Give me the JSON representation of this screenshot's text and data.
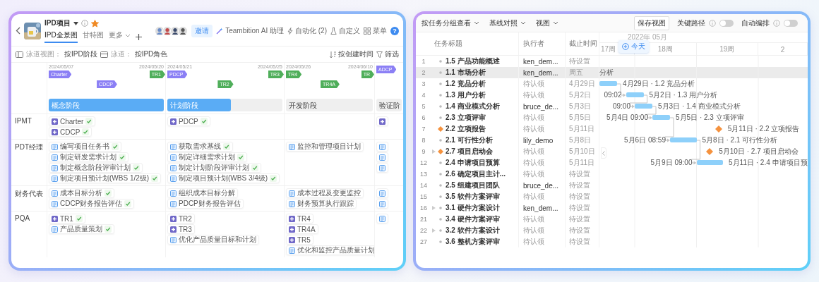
{
  "left_window": {
    "header": {
      "title": "IPD项目",
      "starred": true,
      "tabs": [
        {
          "label": "IPD全景图",
          "selected": true,
          "kind": "view"
        },
        {
          "label": "甘特图",
          "selected": false,
          "kind": "view"
        },
        {
          "label": "更多",
          "selected": false,
          "kind": "more"
        }
      ],
      "invite": "邀请",
      "actions": [
        {
          "kind": "ai",
          "label": "Teambition AI 助理"
        },
        {
          "kind": "automation",
          "label": "自动化 (2)"
        },
        {
          "kind": "customize",
          "label": "自定义"
        },
        {
          "kind": "menu",
          "label": "菜单"
        }
      ],
      "help": "?"
    },
    "toolbar": {
      "view_label": "泳道视图：",
      "view_value": "按IPD阶段",
      "lane_label": "泳道：",
      "lane_value": "按IPD角色",
      "sort": "按创建时间",
      "filter": "筛选"
    },
    "timeline": [
      {
        "start_date": "2024/05/07",
        "end_date": "2024/05/20",
        "upper_flags": [
          {
            "label": "Charter",
            "color": "#8b7ff5"
          },
          {
            "label": "TR1",
            "color": "#4fae5a"
          }
        ],
        "lower_flags": [
          {
            "label": "CDCP",
            "color": "#8b7ff5"
          }
        ],
        "phase": {
          "label": "概念阶段",
          "level": 1
        }
      },
      {
        "start_date": "2024/05/21",
        "end_date": "2024/05/25",
        "upper_flags": [
          {
            "label": "PDCP",
            "color": "#8b7ff5"
          },
          {
            "label": "TR3",
            "color": "#4fae5a"
          }
        ],
        "lower_flags": [
          {
            "label": "TR2",
            "color": "#4fae5a"
          }
        ],
        "phase": {
          "label": "计划阶段",
          "level": 0.55
        }
      },
      {
        "start_date": "2024/05/26",
        "end_date": "2024/06/10",
        "upper_flags": [
          {
            "label": "TR4",
            "color": "#4fae5a"
          },
          {
            "label": "TR",
            "color": "#4fae5a"
          }
        ],
        "lower_flags": [
          {
            "label": "TR4A",
            "color": "#4fae5a"
          }
        ],
        "phase": {
          "label": "开发阶段",
          "level": 0
        }
      },
      {
        "upper_flags": [
          {
            "label": "ADCP",
            "color": "#8b7ff5"
          }
        ],
        "phase": {
          "label": "验证阶",
          "level": 0
        }
      }
    ],
    "lanes": [
      {
        "role": "IPMT",
        "cells": [
          [
            {
              "kind": "milestone",
              "label": "Charter",
              "done": true
            },
            {
              "kind": "milestone",
              "label": "CDCP",
              "done": true
            }
          ],
          [
            {
              "kind": "milestone",
              "label": "PDCP",
              "done": true
            }
          ],
          [],
          [
            {
              "kind": "milestone",
              "done": false
            }
          ]
        ]
      },
      {
        "role": "PDT经理",
        "cells": [
          [
            {
              "kind": "task",
              "label": "编写项目任务书",
              "done": true
            },
            {
              "kind": "task",
              "label": "制定研发需求计划",
              "done": true
            },
            {
              "kind": "task",
              "label": "制定概念阶段评审计划",
              "done": true
            },
            {
              "kind": "task",
              "label": "制定项目预计划(WBS 1/2级)",
              "done": true
            }
          ],
          [
            {
              "kind": "task",
              "label": "获取需求基线",
              "done": true
            },
            {
              "kind": "task",
              "label": "制定详细需求计划",
              "done": true
            },
            {
              "kind": "task",
              "label": "制定计划阶段评审计划",
              "done": true
            },
            {
              "kind": "task",
              "label": "制定项目预计划(WBS 3/4级)",
              "done": true
            }
          ],
          [
            {
              "kind": "task",
              "label": "监控和管理项目计划",
              "done": false
            }
          ],
          [
            {
              "kind": "task",
              "done": false
            },
            {
              "kind": "task",
              "done": false
            },
            {
              "kind": "task",
              "done": false
            }
          ]
        ]
      },
      {
        "role": "财务代表",
        "cells": [
          [
            {
              "kind": "task",
              "label": "成本目标分析",
              "done": true
            },
            {
              "kind": "task",
              "label": "CDCP财务报告评估",
              "done": true
            }
          ],
          [
            {
              "kind": "task",
              "label": "组织成本目标分解",
              "done": false
            },
            {
              "kind": "task",
              "label": "PDCP财务报告评估",
              "done": false
            }
          ],
          [
            {
              "kind": "task",
              "label": "成本过程及变更监控",
              "done": false
            },
            {
              "kind": "task",
              "label": "财务预算执行跟踪",
              "done": false
            }
          ],
          [
            {
              "kind": "task",
              "done": false
            },
            {
              "kind": "task",
              "done": false
            }
          ]
        ]
      },
      {
        "role": "PQA",
        "cells": [
          [
            {
              "kind": "milestone",
              "label": "TR1",
              "done": true
            },
            {
              "kind": "task",
              "label": "产品质量策划",
              "done": true
            }
          ],
          [
            {
              "kind": "milestone",
              "label": "TR2",
              "done": false
            },
            {
              "kind": "milestone",
              "label": "TR3",
              "done": false
            },
            {
              "kind": "task",
              "label": "优化产品质量目标和计划",
              "done": false
            }
          ],
          [
            {
              "kind": "milestone",
              "label": "TR4",
              "done": false
            },
            {
              "kind": "milestone",
              "label": "TR4A",
              "done": false
            },
            {
              "kind": "milestone",
              "label": "TR5",
              "done": false
            },
            {
              "kind": "task",
              "label": "优化和监控产品质量计划",
              "done": false
            }
          ],
          [
            {
              "kind": "task",
              "done": false
            }
          ]
        ]
      }
    ]
  },
  "right_window": {
    "toolbar": {
      "menus": [
        "按任务分组查看",
        "基线对照",
        "视图"
      ],
      "save_view": "保存视图",
      "toggles": [
        {
          "label": "关键路径",
          "on": false
        },
        {
          "label": "自动编排",
          "on": false
        }
      ]
    },
    "columns": [
      "任务标题",
      "执行者",
      "截止时间"
    ],
    "gantt": {
      "months": [
        "2022年 05月"
      ],
      "weeks": [
        "17周",
        "18周",
        "19周",
        "2"
      ],
      "today": "今天"
    },
    "rows": [
      {
        "number": "1",
        "title": "1.5 产品功能概述",
        "kind": "task",
        "expandable": false,
        "assignee": "ken_dem...",
        "assigned": true,
        "due": "待设置",
        "selected": false
      },
      {
        "number": "2",
        "title": "1.1 市场分析",
        "kind": "task",
        "expandable": false,
        "assignee": "ken_dem...",
        "assigned": true,
        "due": "周五",
        "selected": true,
        "bar": {
          "kind": "label",
          "end_label": "分析"
        }
      },
      {
        "number": "3",
        "title": "1.2 竞品分析",
        "kind": "task",
        "expandable": false,
        "assignee": "待认领",
        "assigned": false,
        "due": "4月29日",
        "selected": false,
        "bar": {
          "kind": "span",
          "end_label": "4月29日 · 1.2 竞品分析",
          "linked": false
        }
      },
      {
        "number": "4",
        "title": "1.3 用户分析",
        "kind": "task",
        "expandable": false,
        "assignee": "待认领",
        "assigned": false,
        "due": "5月2日",
        "selected": false,
        "bar": {
          "kind": "span",
          "start_label": "09:02",
          "end_label": "5月2日 · 1.3 用户分析",
          "linked": true
        }
      },
      {
        "number": "5",
        "title": "1.4 商业模式分析",
        "kind": "task",
        "expandable": false,
        "assignee": "bruce_de...",
        "assigned": true,
        "due": "5月3日",
        "selected": false,
        "bar": {
          "kind": "span",
          "start_label": "09:00",
          "end_label": "5月3日 · 1.4 商业模式分析",
          "linked": true
        }
      },
      {
        "number": "6",
        "title": "2.3 立项评审",
        "kind": "task",
        "expandable": false,
        "assignee": "待认领",
        "assigned": false,
        "due": "5月5日",
        "selected": false,
        "bar": {
          "kind": "span",
          "start_label": "5月4日 09:00",
          "end_label": "5月5日 · 2.3 立项评审",
          "linked": true
        }
      },
      {
        "number": "7",
        "title": "2.2 立项报告",
        "kind": "milestone",
        "expandable": false,
        "assignee": "待认领",
        "assigned": false,
        "due": "5月11日",
        "selected": false,
        "bar": {
          "kind": "milestone",
          "end_label": "5月11日 · 2.2 立项报告",
          "linked": false
        }
      },
      {
        "number": "8",
        "title": "2.1 可行性分析",
        "kind": "task",
        "expandable": false,
        "assignee": "lily_demo",
        "assigned": true,
        "due": "5月8日",
        "selected": false,
        "bar": {
          "kind": "span",
          "start_label": "5月6日 08:59",
          "end_label": "5月8日 · 2.1 可行性分析",
          "linked": true
        }
      },
      {
        "number": "9",
        "title": "2.7 项目启动会",
        "kind": "milestone",
        "expandable": true,
        "assignee": "待认领",
        "assigned": false,
        "due": "5月10日",
        "selected": false,
        "bar": {
          "kind": "milestone",
          "end_label": "5月10日 · 2.7 项目启动会",
          "linked": false
        }
      },
      {
        "number": "12",
        "title": "2.4 申请项目预算",
        "kind": "task",
        "expandable": false,
        "assignee": "待认领",
        "assigned": false,
        "due": "5月11日",
        "selected": false,
        "bar": {
          "kind": "span",
          "start_label": "5月9日 09:00",
          "end_label": "5月11日 · 2.4 申请项目预",
          "linked": true
        }
      },
      {
        "number": "13",
        "title": "2.6 确定项目主计...",
        "kind": "task",
        "expandable": false,
        "assignee": "待认领",
        "assigned": false,
        "due": "待设置",
        "selected": false
      },
      {
        "number": "14",
        "title": "2.5 组建项目团队",
        "kind": "task",
        "expandable": false,
        "assignee": "bruce_de...",
        "assigned": true,
        "due": "待设置",
        "selected": false
      },
      {
        "number": "15",
        "title": "3.5 软件方案评审",
        "kind": "task",
        "expandable": false,
        "assignee": "待认领",
        "assigned": false,
        "due": "待设置",
        "selected": false
      },
      {
        "number": "16",
        "title": "3.1 硬件方案设计",
        "kind": "task",
        "expandable": true,
        "assignee": "ken_dem...",
        "assigned": true,
        "due": "待设置",
        "selected": false
      },
      {
        "number": "21",
        "title": "3.4 硬件方案评审",
        "kind": "task",
        "expandable": false,
        "assignee": "待认领",
        "assigned": false,
        "due": "待设置",
        "selected": false
      },
      {
        "number": "22",
        "title": "3.2 软件方案设计",
        "kind": "task",
        "expandable": true,
        "assignee": "待认领",
        "assigned": false,
        "due": "待设置",
        "selected": false
      },
      {
        "number": "27",
        "title": "3.6 整机方案评审",
        "kind": "task",
        "expandable": false,
        "assignee": "待认领",
        "assigned": false,
        "due": "待设置",
        "selected": false
      }
    ]
  }
}
